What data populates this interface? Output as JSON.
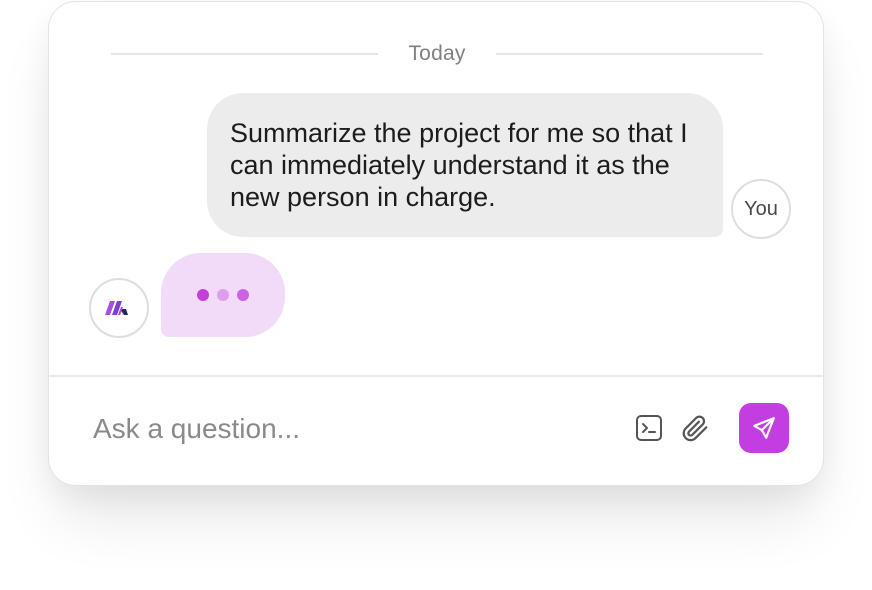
{
  "conversation": {
    "date_label": "Today",
    "user_message": {
      "text": "Summarize the project for me so that I can immediately understand it as the new person in charge.",
      "avatar_label": "You"
    },
    "assistant": {
      "status": "typing",
      "logo_icon": "brand-logo-icon",
      "dot_colors": [
        "#c23fd9",
        "#dca0eb",
        "#cc63e3"
      ]
    }
  },
  "composer": {
    "placeholder": "Ask a question...",
    "value": "",
    "icons": {
      "terminal": "terminal-icon",
      "attach": "paperclip-icon",
      "send": "send-icon"
    }
  },
  "colors": {
    "accent": "#c23ee0",
    "typing_bubble": "#f1dbf8",
    "user_bubble": "#ececec"
  }
}
